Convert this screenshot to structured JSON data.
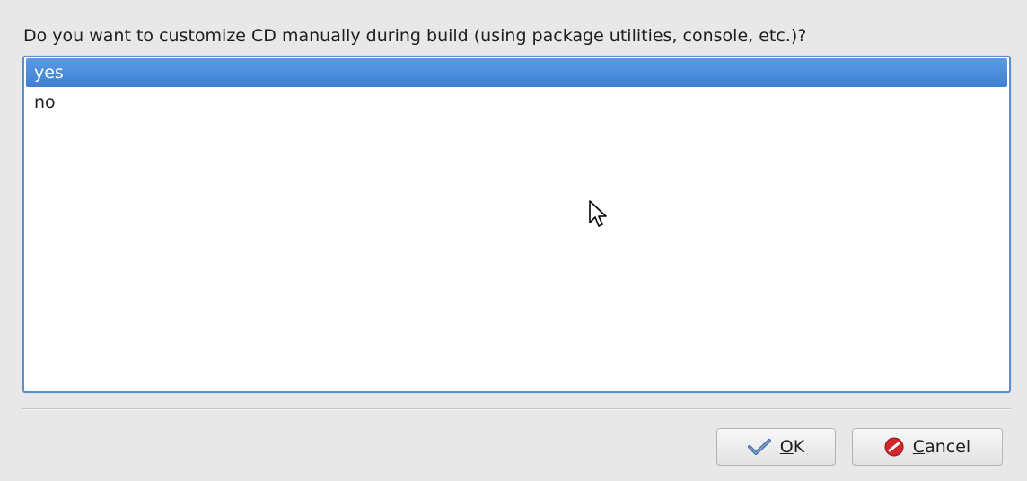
{
  "dialog": {
    "question": "Do you want to customize CD manually during build (using package utilities, console, etc.)?",
    "options": [
      {
        "label": "yes",
        "selected": true
      },
      {
        "label": "no",
        "selected": false
      }
    ]
  },
  "buttons": {
    "ok": {
      "mnemonic": "O",
      "rest": "K",
      "icon": "checkmark-icon"
    },
    "cancel": {
      "mnemonic": "C",
      "rest": "ancel",
      "icon": "cancel-icon"
    }
  },
  "colors": {
    "selection": "#4a8ad9",
    "list_border": "#5b8fd2",
    "cancel_red": "#d0272a"
  }
}
